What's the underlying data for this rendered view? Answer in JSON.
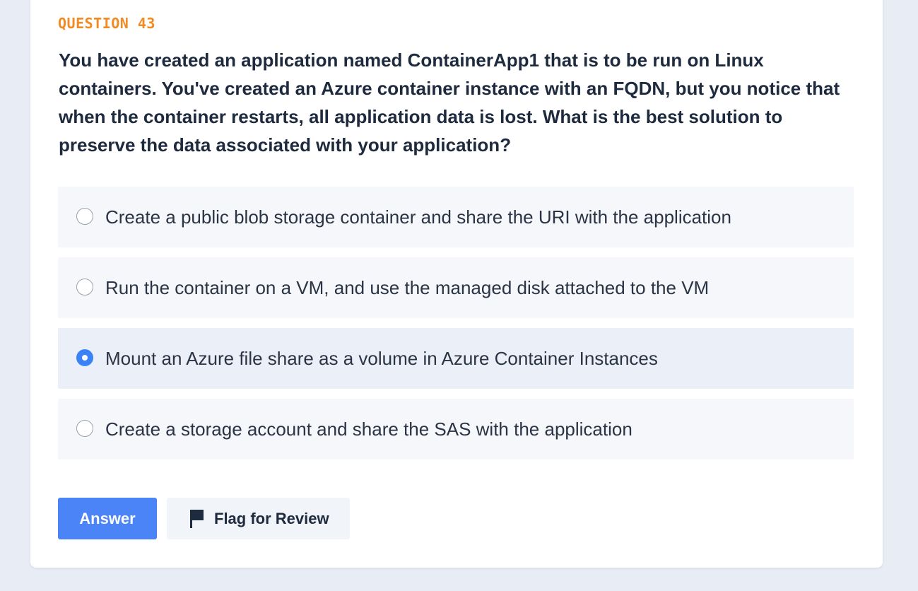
{
  "question": {
    "number_label": "QUESTION 43",
    "text": "You have created an application named ContainerApp1 that is to be run on Linux containers. You've created an Azure container instance with an FQDN, but you notice that when the container restarts, all application data is lost. What is the best solution to preserve the data associated with your application?"
  },
  "options": [
    {
      "label": "Create a public blob storage container and share the URI with the application",
      "selected": false
    },
    {
      "label": "Run the container on a VM, and use the managed disk attached to the VM",
      "selected": false
    },
    {
      "label": "Mount an Azure file share as a volume in Azure Container Instances",
      "selected": true
    },
    {
      "label": "Create a storage account and share the SAS with the application",
      "selected": false
    }
  ],
  "actions": {
    "answer_label": "Answer",
    "flag_label": "Flag for Review",
    "flag_icon": "flag-icon"
  },
  "colors": {
    "accent": "#4a84f7",
    "question_number": "#f28a24",
    "selected_option_bg": "#ebf0f8"
  }
}
